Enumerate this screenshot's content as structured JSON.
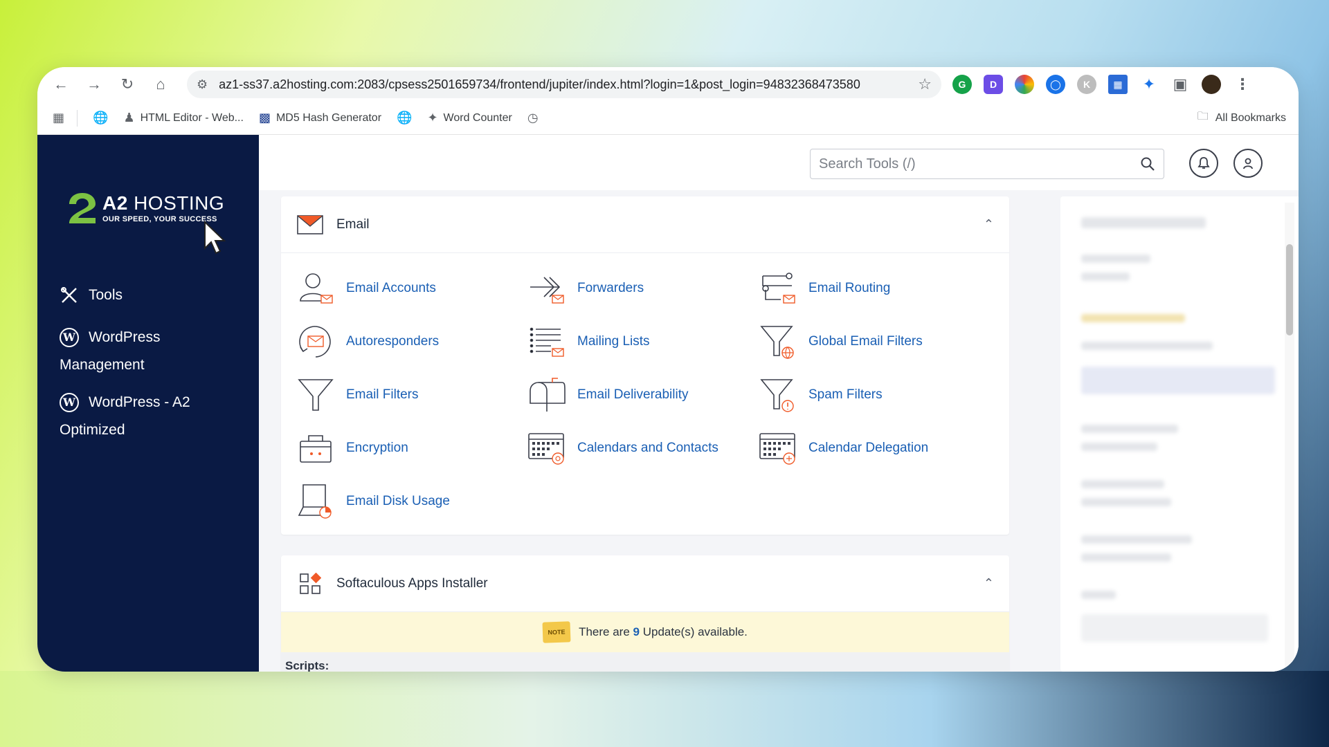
{
  "browser": {
    "url": "az1-ss37.a2hosting.com:2083/cpsess2501659734/frontend/jupiter/index.html?login=1&post_login=94832368473580",
    "bookmarks": [
      {
        "label": "HTML Editor - Web..."
      },
      {
        "label": "MD5 Hash Generator"
      },
      {
        "label": "Word Counter"
      }
    ],
    "all_bookmarks": "All Bookmarks"
  },
  "logo": {
    "brand_a": "A2",
    "brand_b": "HOSTING",
    "tagline": "OUR SPEED, YOUR SUCCESS"
  },
  "sidebar": {
    "items": [
      {
        "label": "Tools"
      },
      {
        "line1": "WordPress",
        "line2": "Management"
      },
      {
        "line1": "WordPress - A2",
        "line2": "Optimized"
      }
    ]
  },
  "search": {
    "placeholder": "Search Tools (/)"
  },
  "email_section": {
    "title": "Email",
    "tools": [
      {
        "label": "Email Accounts",
        "icon": "email-accounts-icon"
      },
      {
        "label": "Forwarders",
        "icon": "forwarders-icon"
      },
      {
        "label": "Email Routing",
        "icon": "email-routing-icon"
      },
      {
        "label": "Autoresponders",
        "icon": "autoresponders-icon"
      },
      {
        "label": "Mailing Lists",
        "icon": "mailing-lists-icon"
      },
      {
        "label": "Global Email Filters",
        "icon": "global-filter-icon"
      },
      {
        "label": "Email Filters",
        "icon": "filter-icon"
      },
      {
        "label": "Email Deliverability",
        "icon": "mailbox-icon"
      },
      {
        "label": "Spam Filters",
        "icon": "spam-filter-icon"
      },
      {
        "label": "Encryption",
        "icon": "encryption-icon"
      },
      {
        "label": "Calendars and Contacts",
        "icon": "calendar-icon"
      },
      {
        "label": "Calendar Delegation",
        "icon": "calendar-delegation-icon"
      },
      {
        "label": "Email Disk Usage",
        "icon": "disk-usage-icon"
      }
    ]
  },
  "softaculous": {
    "title": "Softaculous Apps Installer",
    "note_chip": "NOTE",
    "note_prefix": "There are",
    "note_count": "9",
    "note_suffix": "Update(s) available.",
    "scripts_label": "Scripts:"
  },
  "colors": {
    "sidebar": "#0a1a44",
    "link": "#1a5fb4",
    "accent_orange": "#f05a28",
    "logo_green": "#7cc243"
  }
}
